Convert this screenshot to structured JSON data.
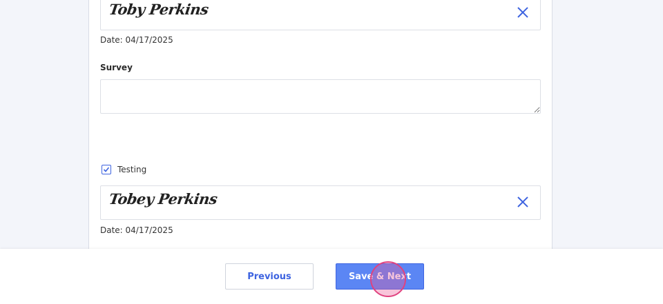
{
  "form": {
    "signature1": {
      "name": "Toby Perkins",
      "date": "Date: 04/17/2025"
    },
    "survey": {
      "label": "Survey",
      "value": ""
    },
    "testing": {
      "label": "Testing",
      "checked": true
    },
    "signature2": {
      "name": "Tobey Perkins",
      "date": "Date: 04/17/2025"
    }
  },
  "footer": {
    "previous_label": "Previous",
    "save_next_label": "Save & Next"
  },
  "colors": {
    "accent": "#3d63e0",
    "primary_button": "#5b86f4",
    "click_indicator": "#e0427f"
  },
  "icons": {
    "clear": "close-icon",
    "check": "checkmark-icon"
  }
}
